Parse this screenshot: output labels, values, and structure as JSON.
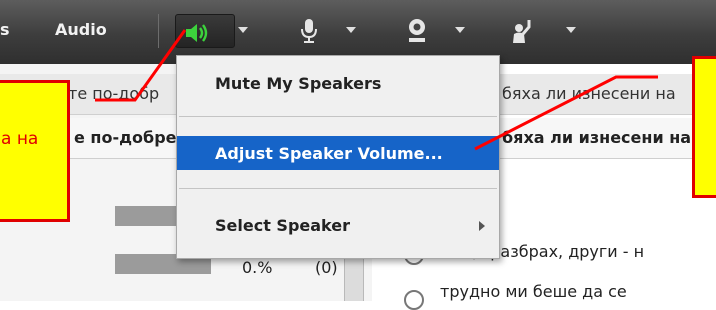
{
  "toolbar": {
    "left_fragment": "s",
    "audio_label": "Audio"
  },
  "questions": {
    "q1_partial_a": "те по-добр",
    "q1_partial_b": "е по-добре",
    "q2_partial_a": "бяха ли изнесени на",
    "q2_partial_b": "бяха ли изнесени на"
  },
  "results": {
    "row2_percent": "0.%",
    "row2_count": "(0)"
  },
  "answers": {
    "a1": "неща разбрах, други - н",
    "a2": "трудно ми беше да се"
  },
  "callout_left": {
    "text": "а на"
  },
  "speaker_menu": {
    "items": [
      {
        "label": "Mute My Speakers"
      },
      {
        "label": "Adjust Speaker Volume..."
      },
      {
        "label": "Select Speaker"
      }
    ]
  },
  "colors": {
    "highlight": "#1664c8",
    "callout_fill": "#ffff00",
    "callout_border": "#e00000",
    "speaker_icon": "#3cd23c"
  }
}
